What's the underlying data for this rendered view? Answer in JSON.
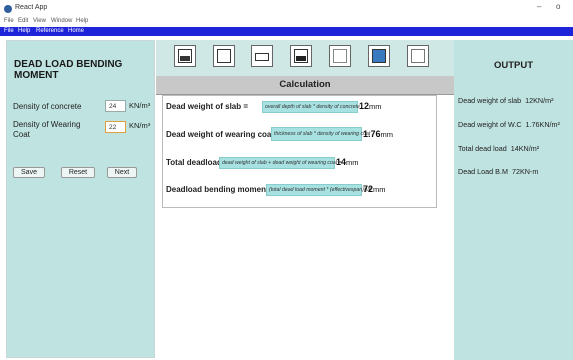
{
  "window": {
    "title": "React App",
    "minimize": "–",
    "maximize": "o"
  },
  "system_menu": [
    "File",
    "Edit",
    "View",
    "Window",
    "Help"
  ],
  "app_menu": [
    "File",
    "Help",
    "Reference",
    "Home"
  ],
  "left_panel": {
    "title": "DEAD LOAD BENDING MOMENT",
    "fields": [
      {
        "label": "Density of concrete",
        "value": "24",
        "unit": "KN/m³"
      },
      {
        "label": "Density of Wearing Coat",
        "value": "22",
        "unit": "KN/m³"
      }
    ],
    "buttons": {
      "save": "Save",
      "reset": "Reset",
      "next": "Next"
    }
  },
  "toolbar": {
    "icons": [
      "image-icon",
      "document-icon",
      "panel-icon",
      "photo-icon",
      "window-icon",
      "picture-icon",
      "edit-icon"
    ]
  },
  "calculation": {
    "title": "Calculation",
    "rows": [
      {
        "label": "Dead weight of slab =",
        "formula": "overall depth of slab * density of concrete",
        "value": "12",
        "unit": "mm"
      },
      {
        "label": "Dead weight of wearing coat =",
        "formula": "thickness of slab * density of wearing coat",
        "value": "1.76",
        "unit": "mm"
      },
      {
        "label": "Total deadload",
        "formula": "dead weight of slab + dead weight of wearing coat =",
        "value": "14",
        "unit": "mm"
      },
      {
        "label": "Deadload bending moment =",
        "formula": "(total dead load moment * (effectivespan)²)/8",
        "value": "72",
        "unit": "mm"
      }
    ]
  },
  "output": {
    "title": "OUTPUT",
    "lines": [
      {
        "label": "Dead weight of slab",
        "value": "12KN/m²"
      },
      {
        "label": "Dead weight of W.C",
        "value": "1.76KN/m²"
      },
      {
        "label": "Total dead load",
        "value": "14KN/m²"
      },
      {
        "label": "Dead Load B.M",
        "value": "72KN-m"
      }
    ]
  }
}
